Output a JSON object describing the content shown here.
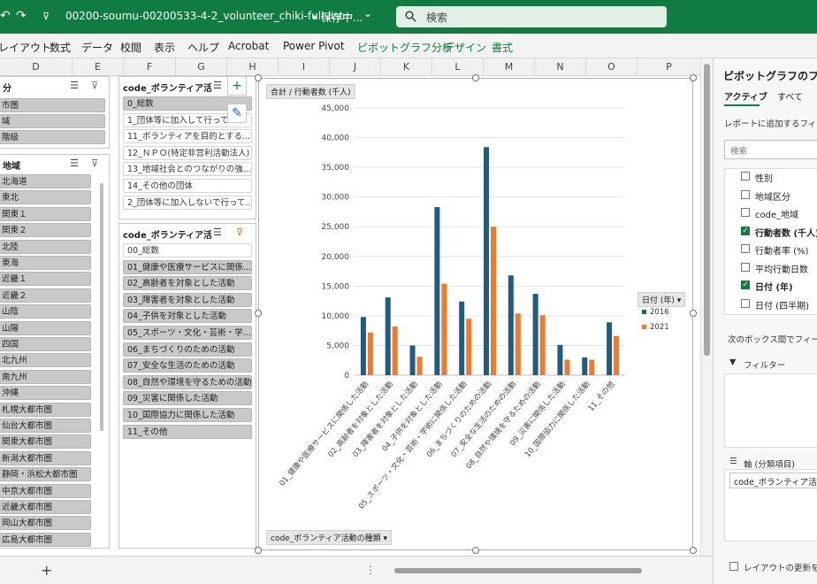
{
  "titlebar": {
    "doc_title": "00200-soumu-00200533-4-2_volunteer_chiki-full-list···",
    "save_state": "• 保存中...",
    "save_chevron": "⌄",
    "search_placeholder": "検索",
    "undo_glyph": "↶",
    "redo_glyph": "↷",
    "qa_glyph": "⊽"
  },
  "ribbon": {
    "tabs": [
      "レイアウト",
      "数式",
      "データ",
      "校閲",
      "表示",
      "ヘルプ",
      "Acrobat",
      "Power Pivot",
      "ピボットグラフ分析",
      "デザイン",
      "書式"
    ]
  },
  "columns": [
    "D",
    "E",
    "F",
    "G",
    "H",
    "I",
    "J",
    "K",
    "L",
    "M",
    "N",
    "O",
    "P"
  ],
  "slicers": {
    "left_top": {
      "title": "分",
      "items": [
        "市圏",
        "域",
        "階級"
      ]
    },
    "left_region": {
      "title": "地域",
      "items": [
        "北海道",
        "東北",
        "関東１",
        "関東２",
        "北陸",
        "東海",
        "近畿１",
        "近畿２",
        "山陰",
        "山陽",
        "四国",
        "北九州",
        "南九州",
        "沖縄",
        "札幌大都市圏",
        "仙台大都市圏",
        "関東大都市圏",
        "新潟大都市圏",
        "静岡・浜松大都市圏",
        "中京大都市圏",
        "近畿大都市圏",
        "岡山大都市圏",
        "広島大都市圏"
      ]
    },
    "mid_top": {
      "title": "code_ボランティア活...",
      "items": [
        "0_総数",
        "1_団体等に加入して行ってい...",
        "11_ボランティアを目的とする...",
        "12_ＮＰＯ(特定非営利活動法人)",
        "13_地域社会とのつながりの強...",
        "14_その他の団体",
        "2_団体等に加入しないで行って..."
      ]
    },
    "mid_bottom": {
      "title": "code_ボランティア活...",
      "items": [
        "00_総数",
        "01_健康や医療サービスに関係...",
        "02_高齢者を対象とした活動",
        "03_障害者を対象とした活動",
        "04_子供を対象とした活動",
        "05_スポーツ・文化・芸術・学...",
        "06_まちづくりのための活動",
        "07_安全な生活のための活動",
        "08_自然や環境を守るための活動",
        "09_災害に関係した活動",
        "10_国際協力に関係した活動",
        "11_その他"
      ]
    },
    "multi_select_glyph": "☰",
    "clear_filter_glyph": "⊽"
  },
  "tools": {
    "add_glyph": "+",
    "brush_glyph": "✎"
  },
  "chart": {
    "value_field_button": "合計 / 行動者数 (千人)",
    "axis_field_button": "code_ボランティア活動の種類 ▾",
    "legend_field_button": "日付 (年) ▾",
    "colors": {
      "2016": "#1f5c7e",
      "2021": "#ef7a2b"
    }
  },
  "chart_data": {
    "type": "bar",
    "title": "",
    "ylabel": "",
    "xlabel": "",
    "ylim": [
      0,
      45000
    ],
    "yticks": [
      0,
      5000,
      10000,
      15000,
      20000,
      25000,
      30000,
      35000,
      40000,
      45000
    ],
    "ytick_labels": [
      "0",
      "5,000",
      "10,000",
      "15,000",
      "20,000",
      "25,000",
      "30,000",
      "35,000",
      "40,000",
      "45,000"
    ],
    "categories": [
      "01_健康や医療サービスに関係した活動",
      "02_高齢者を対象とした活動",
      "03_障害者を対象とした活動",
      "04_子供を対象とした活動",
      "05_スポーツ・文化・芸術・学術に関係した活動",
      "06_まちづくりのための活動",
      "07_安全な生活のための活動",
      "08_自然や環境を守るための活動",
      "09_災害に関係した活動",
      "10_国際協力に関係した活動",
      "11_その他"
    ],
    "series": [
      {
        "name": "2016",
        "values": [
          9800,
          13100,
          5000,
          28300,
          12400,
          38400,
          16800,
          13700,
          5100,
          3000,
          8900
        ]
      },
      {
        "name": "2021",
        "values": [
          7200,
          8200,
          3100,
          15400,
          9500,
          25000,
          10400,
          10100,
          2600,
          2600,
          6600
        ]
      }
    ],
    "legend_position": "right",
    "grid": true
  },
  "bottombar": {
    "add_sheet": "+",
    "dots": "⋮"
  },
  "pane": {
    "title": "ピボットグラフのフィールド",
    "tab_active": "アクティブ",
    "tab_all": "すべて",
    "instruction": "レポートに追加するフィールドを選択してください:",
    "search_placeholder": "検索",
    "fields": [
      {
        "label": "性別",
        "checked": false
      },
      {
        "label": "地域区分",
        "checked": false
      },
      {
        "label": "code_地域",
        "checked": false
      },
      {
        "label": "行動者数 (千人)",
        "checked": true
      },
      {
        "label": "行動者率 (%)",
        "checked": false
      },
      {
        "label": "平均行動日数",
        "checked": false
      },
      {
        "label": "日付 (年)",
        "checked": true
      },
      {
        "label": "日付 (四半期)",
        "checked": false
      }
    ],
    "drag_hint": "次のボックス間でフィールドをドラッグしてください:",
    "filter_label": "フィルター",
    "axis_label": "軸 (分類項目)",
    "axis_chip": "code_ボランティア活動...",
    "defer_label": "レイアウトの更新を保留する"
  }
}
